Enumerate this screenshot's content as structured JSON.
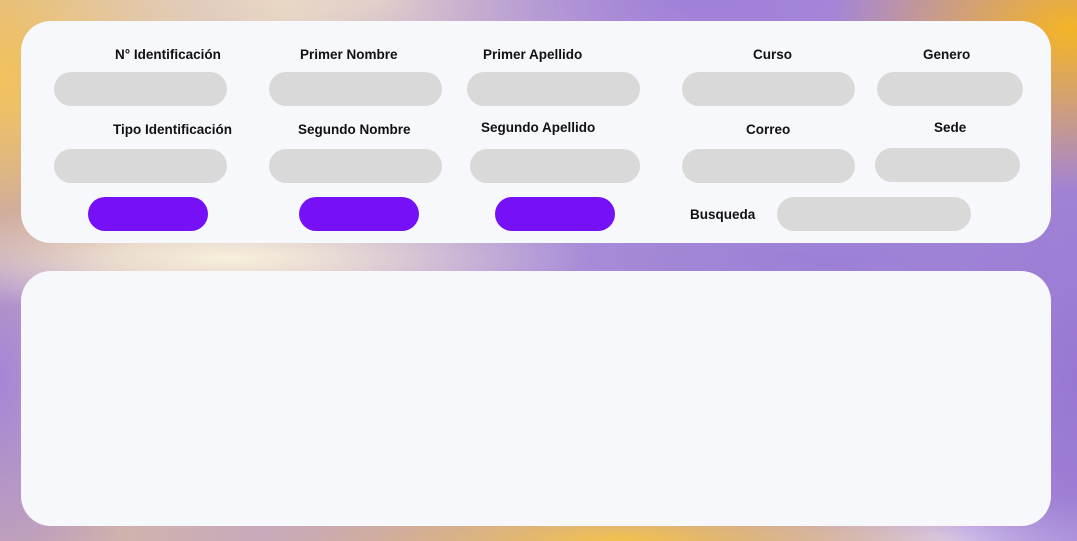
{
  "form": {
    "labels": {
      "id_number": "N° Identificación",
      "first_name": "Primer Nombre",
      "first_surname": "Primer Apellido",
      "course": "Curso",
      "gender": "Genero",
      "id_type": "Tipo Identificación",
      "second_name": "Segundo Nombre",
      "second_surname": "Segundo Apellido",
      "email": "Correo",
      "campus": "Sede",
      "search": "Busqueda"
    },
    "values": {
      "id_number": "",
      "first_name": "",
      "first_surname": "",
      "course": "",
      "gender": "",
      "id_type": "",
      "second_name": "",
      "second_surname": "",
      "email": "",
      "campus": "",
      "search": ""
    },
    "buttons": {
      "button_1": "",
      "button_2": "",
      "button_3": ""
    },
    "colors": {
      "button": "#7510f7",
      "field": "#d9d9d9",
      "card": "#f7f8fc"
    }
  },
  "results": {
    "rows": []
  }
}
